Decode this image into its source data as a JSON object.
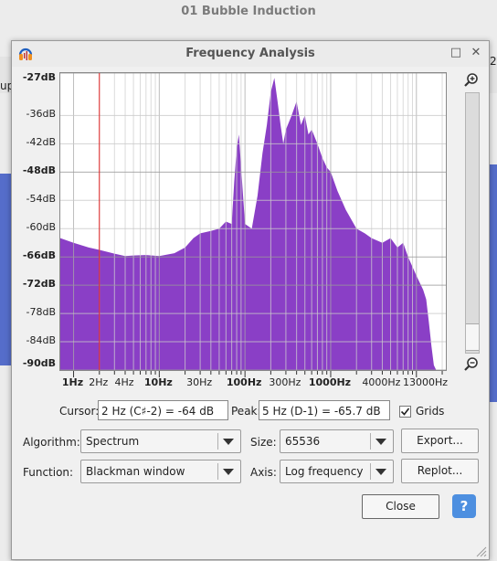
{
  "window": {
    "title": "01 Bubble Induction"
  },
  "background": {
    "left_fragment": "up",
    "right_fragment": "2"
  },
  "dialog": {
    "title": "Frequency Analysis",
    "maximize_glyph": "□",
    "close_glyph": "✕"
  },
  "chart_data": {
    "type": "area",
    "x_scale": "log",
    "xlabel": "",
    "ylabel": "",
    "ylim": [
      -90,
      -27
    ],
    "xlim": [
      0.7,
      22050
    ],
    "y_ticks": [
      {
        "label": "-27dB",
        "bold": true
      },
      {
        "label": "-36dB",
        "bold": false
      },
      {
        "label": "-42dB",
        "bold": false
      },
      {
        "label": "-48dB",
        "bold": true
      },
      {
        "label": "-54dB",
        "bold": false
      },
      {
        "label": "-60dB",
        "bold": false
      },
      {
        "label": "-66dB",
        "bold": true
      },
      {
        "label": "-72dB",
        "bold": true
      },
      {
        "label": "-78dB",
        "bold": false
      },
      {
        "label": "-84dB",
        "bold": false
      },
      {
        "label": "-90dB",
        "bold": true
      }
    ],
    "x_ticks": [
      {
        "label": "1Hz",
        "bold": true
      },
      {
        "label": "2Hz",
        "bold": false
      },
      {
        "label": "4Hz",
        "bold": false
      },
      {
        "label": "10Hz",
        "bold": true
      },
      {
        "label": "30Hz",
        "bold": false
      },
      {
        "label": "100Hz",
        "bold": true
      },
      {
        "label": "300Hz",
        "bold": false
      },
      {
        "label": "1000Hz",
        "bold": true
      },
      {
        "label": "4000Hz",
        "bold": false
      },
      {
        "label": "13000Hz",
        "bold": false
      }
    ],
    "grid": true,
    "cursor_hz": 2,
    "color": "#8a3fc6",
    "series": [
      {
        "points": [
          [
            0.7,
            -62
          ],
          [
            1,
            -63
          ],
          [
            1.5,
            -64
          ],
          [
            2,
            -64.5
          ],
          [
            3,
            -65.3
          ],
          [
            4,
            -65.8
          ],
          [
            5,
            -65.7
          ],
          [
            7,
            -65.6
          ],
          [
            10,
            -65.8
          ],
          [
            15,
            -65.2
          ],
          [
            20,
            -64
          ],
          [
            25,
            -62
          ],
          [
            30,
            -61
          ],
          [
            40,
            -60.5
          ],
          [
            50,
            -60
          ],
          [
            60,
            -58.5
          ],
          [
            70,
            -59
          ],
          [
            75,
            -50
          ],
          [
            80,
            -43
          ],
          [
            85,
            -40
          ],
          [
            90,
            -47
          ],
          [
            100,
            -59
          ],
          [
            120,
            -60
          ],
          [
            140,
            -53
          ],
          [
            160,
            -44
          ],
          [
            180,
            -38
          ],
          [
            200,
            -31
          ],
          [
            220,
            -28
          ],
          [
            240,
            -33
          ],
          [
            260,
            -38
          ],
          [
            280,
            -42
          ],
          [
            300,
            -39
          ],
          [
            350,
            -36
          ],
          [
            400,
            -33
          ],
          [
            450,
            -38
          ],
          [
            500,
            -36
          ],
          [
            550,
            -40
          ],
          [
            600,
            -39
          ],
          [
            700,
            -42
          ],
          [
            800,
            -45
          ],
          [
            900,
            -47
          ],
          [
            1000,
            -48
          ],
          [
            1200,
            -52
          ],
          [
            1500,
            -56
          ],
          [
            2000,
            -60
          ],
          [
            2500,
            -61
          ],
          [
            3000,
            -62
          ],
          [
            4000,
            -63
          ],
          [
            5000,
            -62
          ],
          [
            6000,
            -64
          ],
          [
            7000,
            -63
          ],
          [
            8000,
            -66
          ],
          [
            10000,
            -70
          ],
          [
            12000,
            -73
          ],
          [
            13000,
            -75
          ],
          [
            14000,
            -80
          ],
          [
            15000,
            -85
          ],
          [
            16000,
            -89
          ],
          [
            17000,
            -91
          ]
        ]
      }
    ]
  },
  "controls": {
    "cursor_label": "Cursor:",
    "cursor_value": "2 Hz (C♯-2) = -64 dB",
    "peak_label": "Peak:",
    "peak_value": "5 Hz (D-1) = -65.7 dB",
    "grids_label": "Grids",
    "grids_checked": true,
    "algorithm_label": "Algorithm:",
    "algorithm_value": "Spectrum",
    "size_label": "Size:",
    "size_value": "65536",
    "function_label": "Function:",
    "function_value": "Blackman window",
    "axis_label": "Axis:",
    "axis_value": "Log frequency",
    "export_label": "Export...",
    "replot_label": "Replot...",
    "close_label": "Close",
    "help_glyph": "?"
  }
}
